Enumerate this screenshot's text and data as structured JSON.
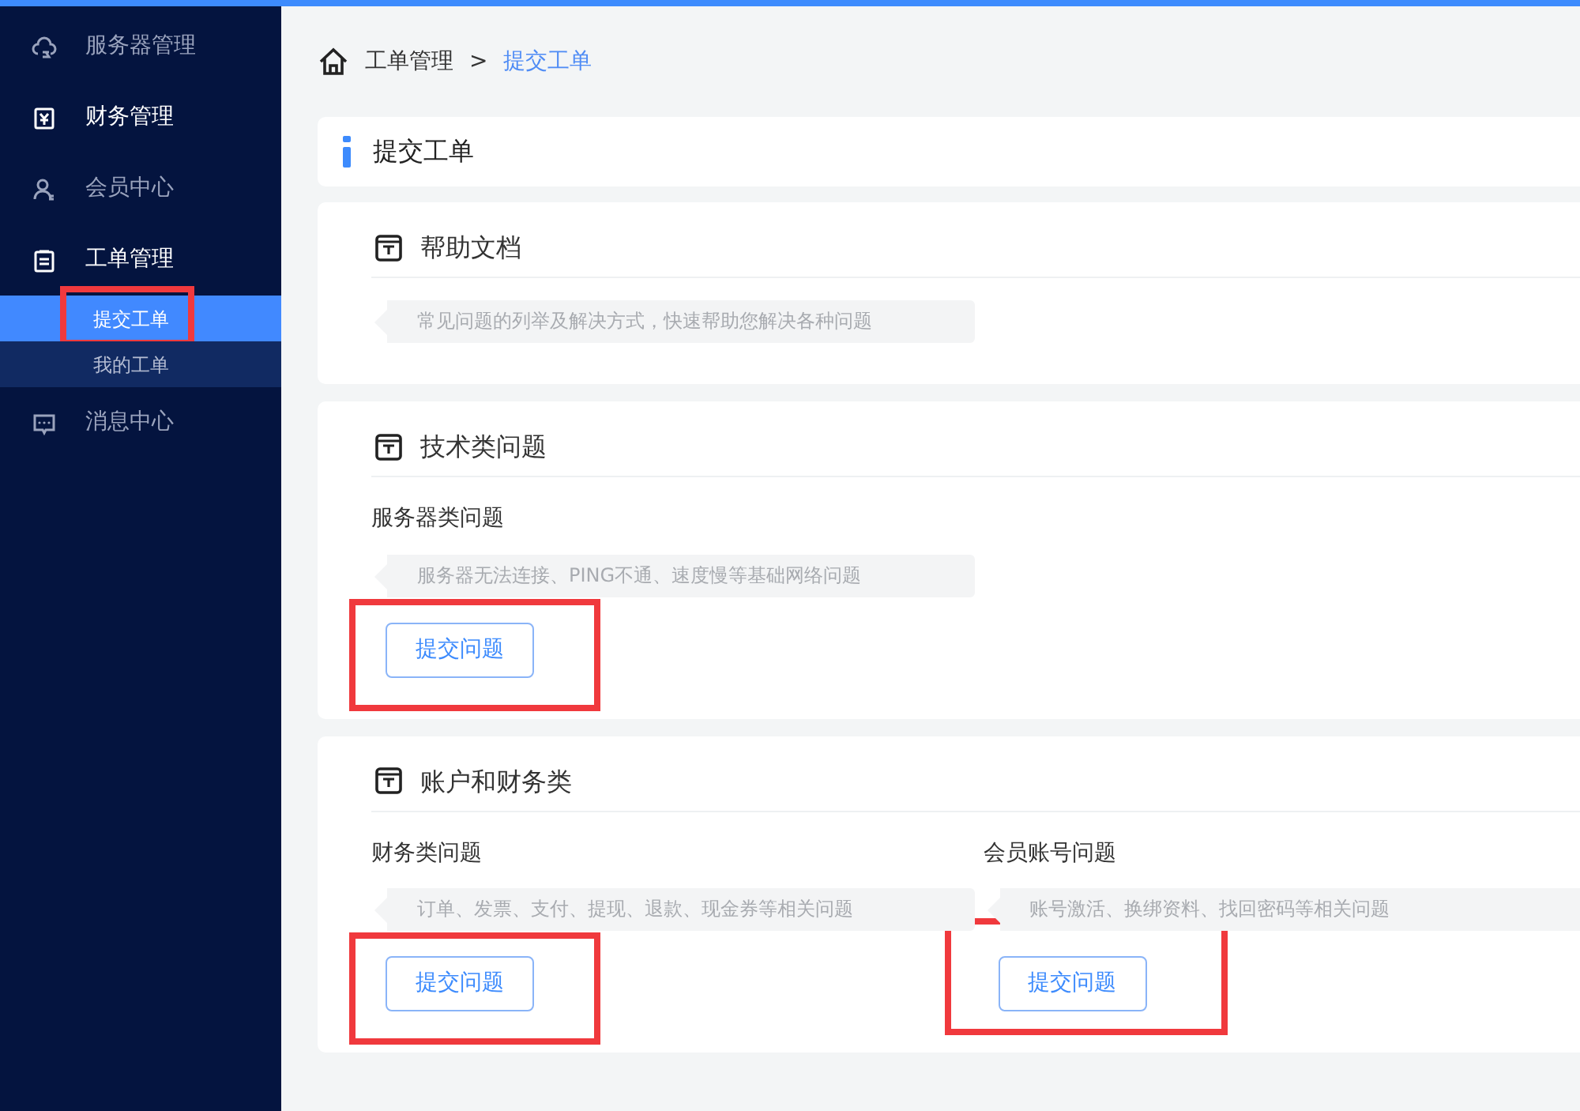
{
  "sidebar": {
    "items": [
      {
        "label": "服务器管理",
        "highlighted": false
      },
      {
        "label": "财务管理",
        "highlighted": true
      },
      {
        "label": "会员中心",
        "highlighted": false
      },
      {
        "label": "工单管理",
        "highlighted": true,
        "children": [
          {
            "label": "提交工单",
            "selected": true,
            "annotated": true
          },
          {
            "label": "我的工单",
            "selected": false,
            "annotated": false
          }
        ]
      },
      {
        "label": "消息中心",
        "highlighted": false
      }
    ]
  },
  "breadcrumb": [
    {
      "label": "工单管理",
      "current": false
    },
    {
      "label": "提交工单",
      "current": true
    }
  ],
  "breadcrumb_separator": ">",
  "page_title": "提交工单",
  "sections": [
    {
      "title": "帮助文档",
      "groups": [
        {
          "description": "常见问题的列举及解决方式，快速帮助您解决各种问题"
        }
      ]
    },
    {
      "title": "技术类问题",
      "groups": [
        {
          "subtitle": "服务器类问题",
          "description": "服务器无法连接、PING不通、速度慢等基础网络问题",
          "button": "提交问题",
          "annotated": true
        }
      ]
    },
    {
      "title": "账户和财务类",
      "groups": [
        {
          "subtitle": "财务类问题",
          "description": "订单、发票、支付、提现、退款、现金券等相关问题",
          "button": "提交问题",
          "annotated": true
        },
        {
          "subtitle": "会员账号问题",
          "description": "账号激活、换绑资料、找回密码等相关问题",
          "button": "提交问题",
          "annotated": true
        }
      ]
    }
  ]
}
